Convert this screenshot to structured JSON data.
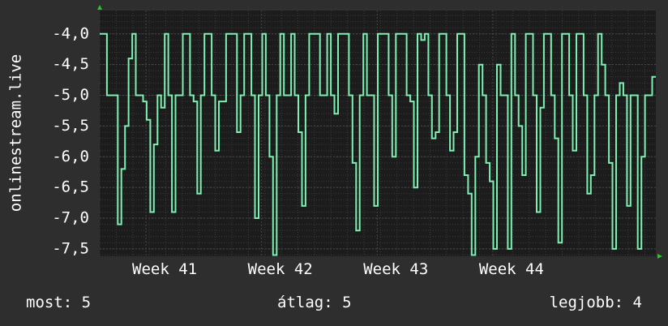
{
  "colors": {
    "background": "#2e2e2e",
    "plot_background": "#1c1c1c",
    "grid_major": "#474747",
    "grid_minor": "#3a3a3a",
    "series": "#7ef0b2",
    "axis_arrow": "#22cc22"
  },
  "chart_data": {
    "type": "line",
    "ylabel": "onlinestream.live",
    "ylim": [
      -7.62,
      -3.62
    ],
    "y_ticks": [
      -4.0,
      -4.5,
      -5.0,
      -5.5,
      -6.0,
      -6.5,
      -7.0,
      -7.5
    ],
    "y_tick_labels": [
      "-4,0",
      "-4,5",
      "-5,0",
      "-5,5",
      "-6,0",
      "-6,5",
      "-7,0",
      "-7,5"
    ],
    "x_range": [
      0,
      48.1
    ],
    "x_ticks": [
      4,
      14,
      24,
      34
    ],
    "x_tick_labels": [
      "Week 41",
      "Week 42",
      "Week 43",
      "Week 44"
    ],
    "grid": true,
    "series": [
      {
        "values": [
          -4.0,
          -4.0,
          -5.0,
          -5.0,
          -5.0,
          -7.1,
          -6.2,
          -5.5,
          -4.4,
          -4.0,
          -5.0,
          -5.0,
          -5.1,
          -5.4,
          -6.9,
          -5.8,
          -5.0,
          -5.2,
          -4.0,
          -5.0,
          -6.9,
          -5.0,
          -5.0,
          -4.0,
          -4.0,
          -5.0,
          -5.1,
          -6.6,
          -5.0,
          -4.0,
          -4.0,
          -5.0,
          -5.9,
          -5.1,
          -5.1,
          -4.0,
          -4.0,
          -4.0,
          -5.6,
          -5.0,
          -4.0,
          -4.0,
          -5.0,
          -7.0,
          -5.0,
          -4.0,
          -5.0,
          -6.0,
          -7.6,
          -5.0,
          -4.0,
          -5.0,
          -5.0,
          -4.0,
          -5.0,
          -5.6,
          -6.8,
          -5.0,
          -4.0,
          -4.0,
          -4.0,
          -5.0,
          -5.0,
          -4.0,
          -5.0,
          -5.3,
          -4.0,
          -4.0,
          -4.0,
          -5.0,
          -6.1,
          -7.2,
          -5.0,
          -4.0,
          -5.0,
          -5.0,
          -6.8,
          -4.0,
          -4.0,
          -4.0,
          -5.0,
          -6.0,
          -4.0,
          -4.0,
          -4.0,
          -5.0,
          -5.1,
          -6.5,
          -4.0,
          -4.1,
          -4.0,
          -5.0,
          -5.7,
          -5.6,
          -4.0,
          -4.0,
          -5.0,
          -5.9,
          -5.6,
          -4.0,
          -4.0,
          -6.3,
          -6.6,
          -7.6,
          -6.0,
          -4.5,
          -5.0,
          -6.1,
          -6.4,
          -7.5,
          -4.5,
          -5.0,
          -5.0,
          -7.5,
          -4.0,
          -5.0,
          -5.5,
          -6.3,
          -4.0,
          -4.0,
          -5.0,
          -6.9,
          -5.2,
          -4.0,
          -4.0,
          -5.0,
          -5.7,
          -7.4,
          -4.0,
          -4.0,
          -5.0,
          -5.9,
          -4.0,
          -4.0,
          -5.0,
          -6.6,
          -6.3,
          -5.0,
          -4.0,
          -4.5,
          -5.0,
          -6.1,
          -7.5,
          -5.0,
          -4.8,
          -5.0,
          -6.8,
          -5.0,
          -5.0,
          -7.5,
          -6.0,
          -5.0,
          -5.0,
          -4.7
        ]
      }
    ]
  },
  "footer": {
    "now": "most: 5",
    "avg": "átlag: 5",
    "best": "legjobb: 4"
  }
}
